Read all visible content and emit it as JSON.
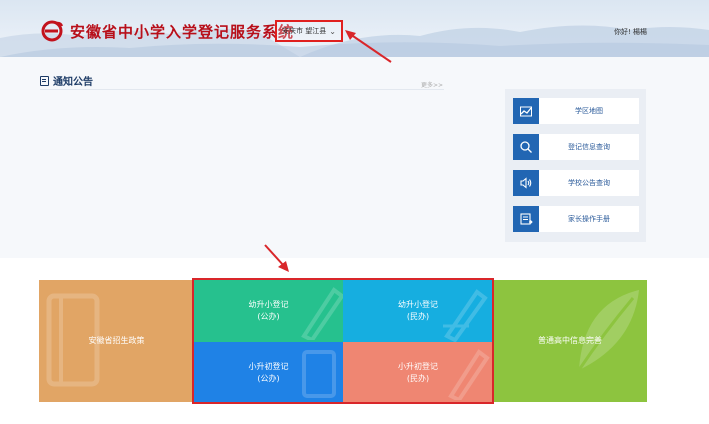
{
  "header": {
    "title": "安徽省中小学入学登记服务系统",
    "location_select": "安庆市 望江县",
    "greeting": "你好! 楊楊"
  },
  "notice": {
    "title": "通知公告",
    "more_link": "更多>>"
  },
  "quick_links": [
    {
      "label": "学区地图",
      "icon": "map-icon"
    },
    {
      "label": "登记信息查询",
      "icon": "search-icon"
    },
    {
      "label": "学校公告查询",
      "icon": "speaker-icon"
    },
    {
      "label": "家长操作手册",
      "icon": "manual-icon"
    }
  ],
  "tiles": {
    "policy": "安徽省招生政策",
    "kinder_public": "幼升小登记\n(公办)",
    "kinder_private": "幼升小登记\n(民办)",
    "primary_public": "小升初登记\n(公办)",
    "primary_private": "小升初登记\n(民办)",
    "high_school": "普通高中信息完善"
  },
  "colors": {
    "brand_red": "#b80f1a",
    "highlight_red": "#d9262a",
    "quick_icon_blue": "#2266b3",
    "policy_tile": "#e1a565",
    "kinder_public_tile": "#26c18e",
    "kinder_private_tile": "#16aee0",
    "primary_public_tile": "#1f82e6",
    "primary_private_tile": "#ef8672",
    "high_school_tile": "#8dc43f"
  }
}
